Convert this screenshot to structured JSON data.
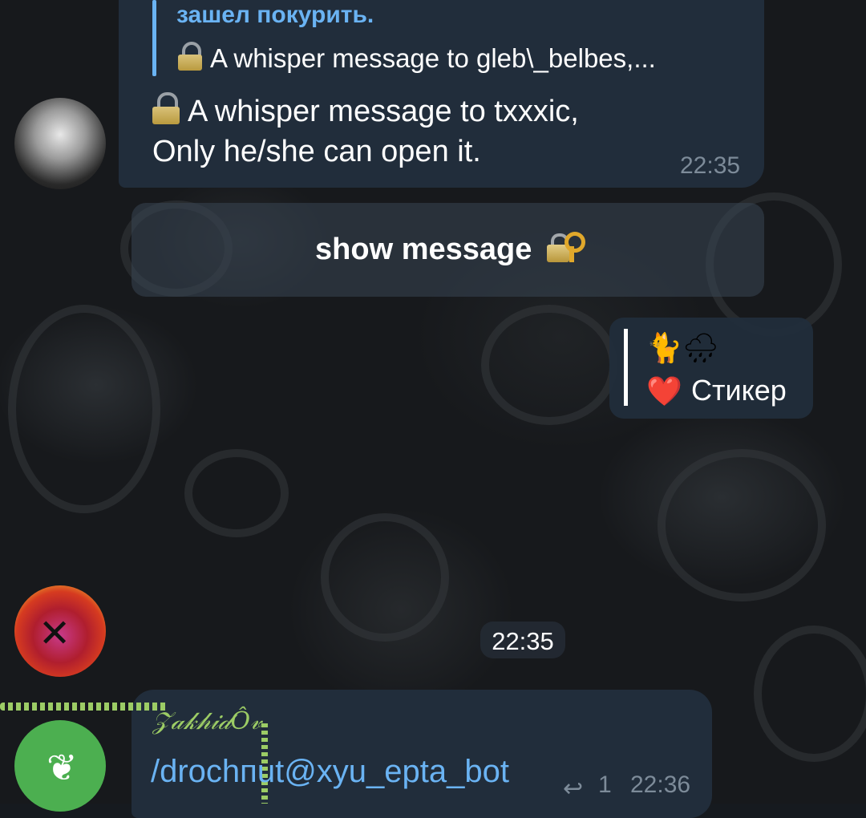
{
  "reply_quote": {
    "title": "зашел покурить.",
    "text": "A whisper message to gleb\\_belbes,..."
  },
  "message1": {
    "line1": "A whisper message to txxxic,",
    "line2": "Only he/she can open it.",
    "time": "22:35"
  },
  "inline_button": {
    "label": "show message"
  },
  "sticker_reply": {
    "emoji_top": "🐈🌧",
    "emoji_heart": "❤️",
    "label": "Стикер"
  },
  "date_pill": "22:35",
  "message2": {
    "sender": "𝒵𝒶𝓀𝒽𝒾𝒹Ô𝓋",
    "text": "/drochпut@xyu_epta_bot",
    "reply_count": "1",
    "time": "22:36"
  },
  "icons": [
    "lock-icon",
    "lock-key-icon",
    "reply-arrow-icon",
    "leaf-icon"
  ],
  "colors": {
    "bubble": "#212d3b",
    "link": "#6ab3f3",
    "time": "#7d8b99",
    "accent_green": "#9ccc65"
  }
}
